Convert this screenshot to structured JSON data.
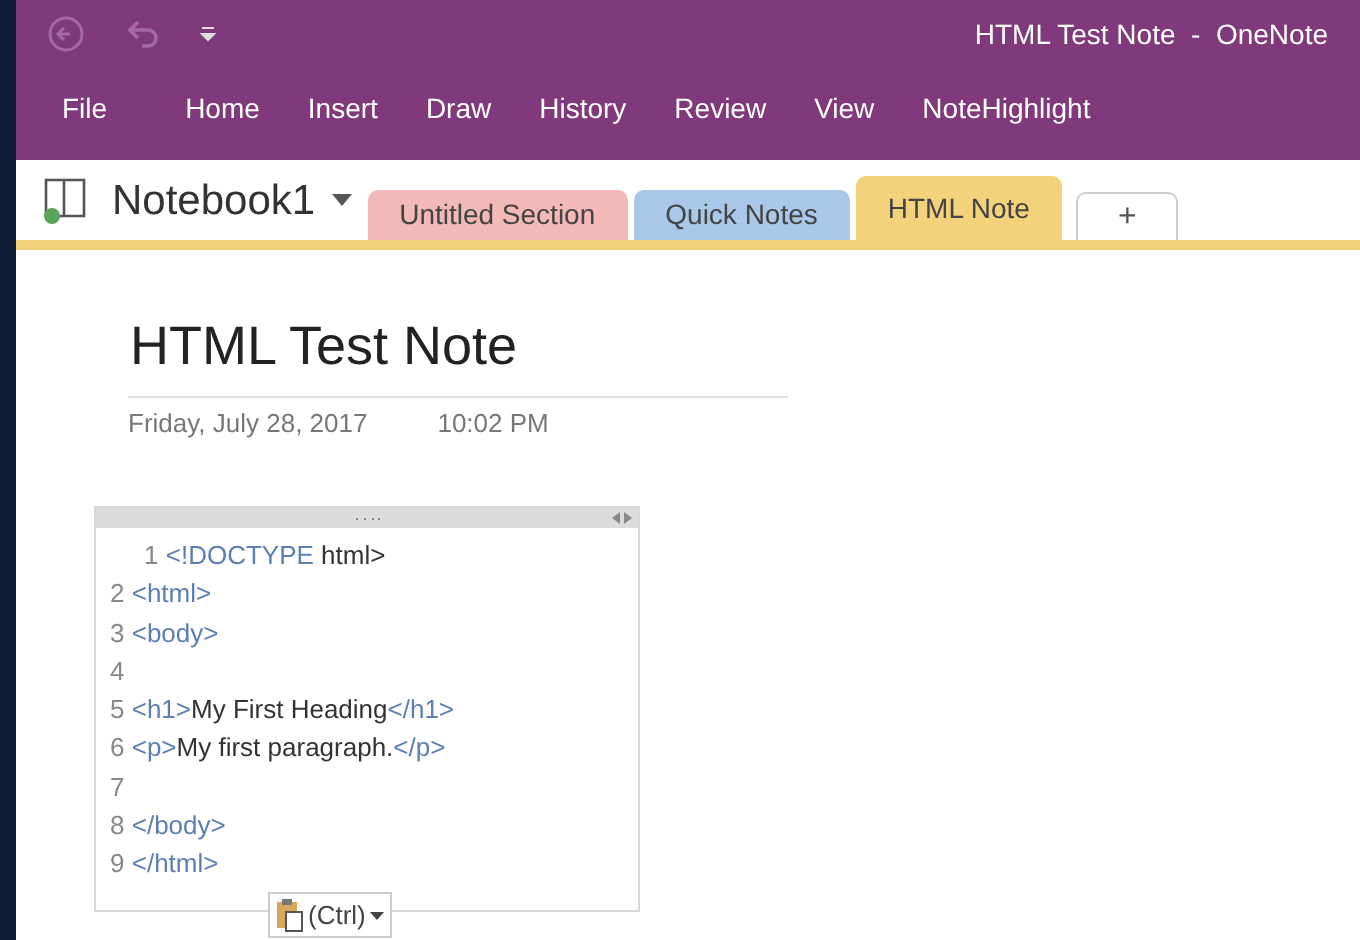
{
  "title_bar": {
    "title": "HTML Test Note  -  OneNote"
  },
  "ribbon_tabs": [
    {
      "label": "File"
    },
    {
      "label": "Home"
    },
    {
      "label": "Insert"
    },
    {
      "label": "Draw"
    },
    {
      "label": "History"
    },
    {
      "label": "Review"
    },
    {
      "label": "View"
    },
    {
      "label": "NoteHighlight"
    }
  ],
  "notebook": {
    "name": "Notebook1"
  },
  "sections": [
    {
      "label": "Untitled Section",
      "color": "#f3b8b8",
      "selected": false
    },
    {
      "label": "Quick Notes",
      "color": "#a9c8e8",
      "selected": false
    },
    {
      "label": "HTML Note",
      "color": "#f2d27a",
      "selected": true
    }
  ],
  "add_section": {
    "label": "+"
  },
  "page": {
    "title": "HTML Test Note",
    "date": "Friday, July 28, 2017",
    "time": "10:02 PM",
    "code_lines": [
      {
        "number": "1",
        "indent": true,
        "segments": [
          {
            "text": "<!DOCTYPE ",
            "kind": "tag"
          },
          {
            "text": "html>",
            "kind": "text"
          }
        ]
      },
      {
        "number": "2",
        "indent": false,
        "segments": [
          {
            "text": "<html>",
            "kind": "tag"
          }
        ]
      },
      {
        "number": "3",
        "indent": false,
        "segments": [
          {
            "text": "<body>",
            "kind": "tag"
          }
        ]
      },
      {
        "number": "4",
        "indent": false
      },
      {
        "number": "5",
        "indent": false,
        "segments": [
          {
            "text": "<h1>",
            "kind": "tag"
          },
          {
            "text": "My First Heading",
            "kind": "text"
          },
          {
            "text": "</h1>",
            "kind": "tag"
          }
        ]
      },
      {
        "number": "6",
        "indent": false,
        "segments": [
          {
            "text": "<p>",
            "kind": "tag"
          },
          {
            "text": "My first paragraph.",
            "kind": "text"
          },
          {
            "text": "</p>",
            "kind": "tag"
          }
        ]
      },
      {
        "number": "7",
        "indent": false
      },
      {
        "number": "8",
        "indent": false,
        "segments": [
          {
            "text": "</body>",
            "kind": "tag"
          }
        ]
      },
      {
        "number": "9",
        "indent": false,
        "segments": [
          {
            "text": "</html>",
            "kind": "tag"
          }
        ]
      }
    ],
    "paste_options": {
      "label": "(Ctrl)"
    }
  }
}
